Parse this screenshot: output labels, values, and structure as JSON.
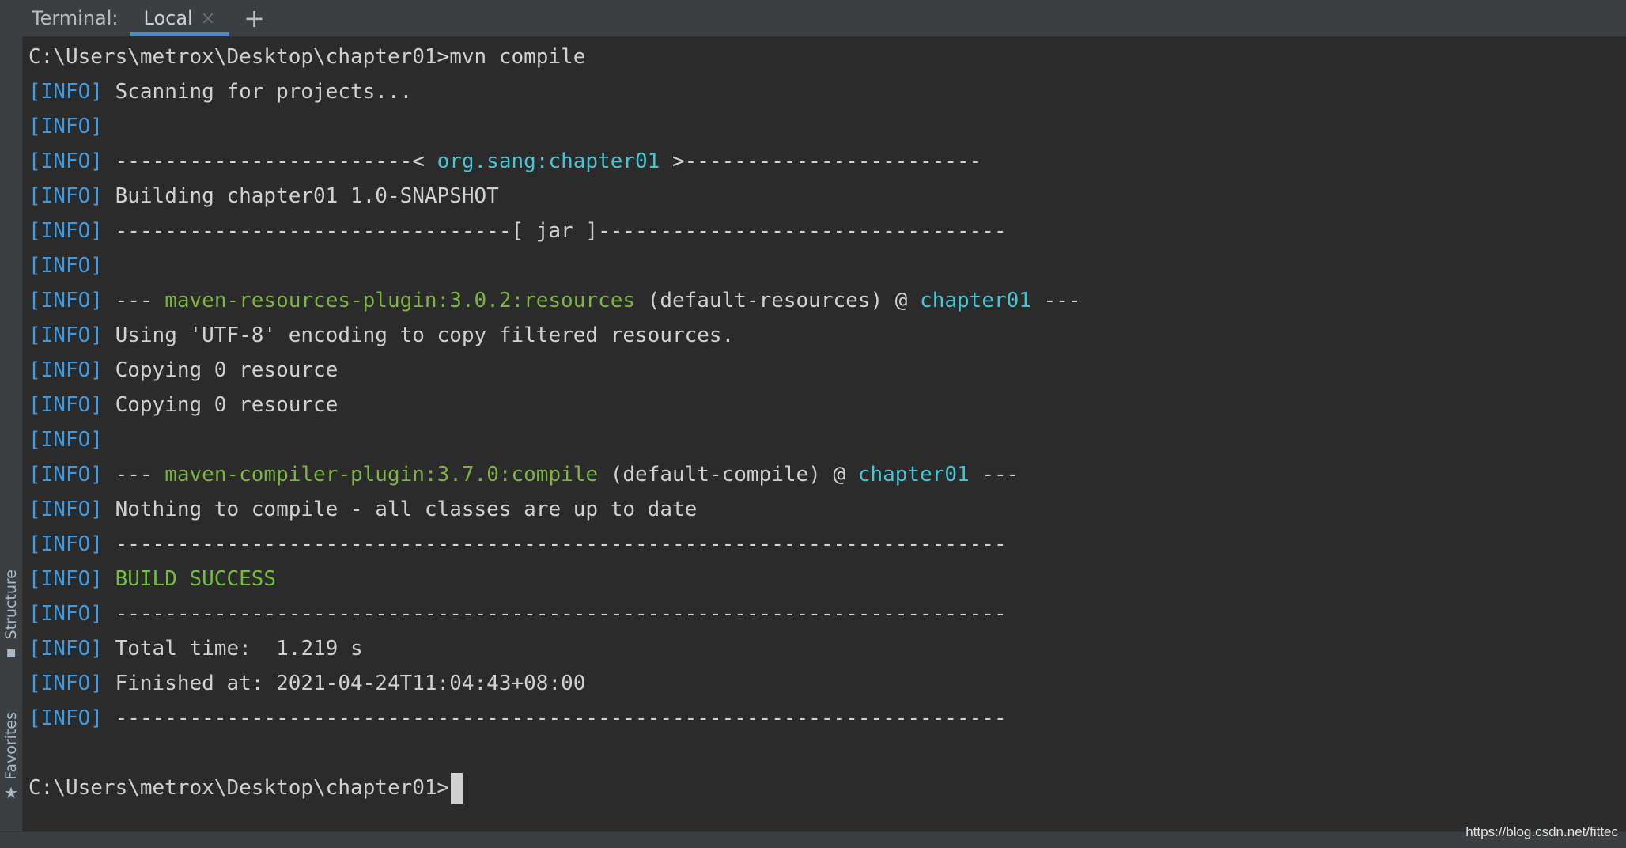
{
  "tabbar": {
    "title": "Terminal:",
    "tab_label": "Local",
    "close_icon": "×",
    "add_icon": "+"
  },
  "rail": {
    "structure_label": "Structure",
    "favorites_label": "Favorites"
  },
  "terminal": {
    "lines": [
      {
        "segments": [
          {
            "text": "C:\\Users\\metrox\\Desktop\\chapter01>mvn compile",
            "color": "default"
          }
        ]
      },
      {
        "segments": [
          {
            "text": "[INFO]",
            "color": "info"
          },
          {
            "text": " Scanning for projects...",
            "color": "default"
          }
        ]
      },
      {
        "segments": [
          {
            "text": "[INFO]",
            "color": "info"
          }
        ]
      },
      {
        "segments": [
          {
            "text": "[INFO]",
            "color": "info"
          },
          {
            "text": " ------------------------< ",
            "color": "default"
          },
          {
            "text": "org.sang:chapter01",
            "color": "cyan"
          },
          {
            "text": " >------------------------",
            "color": "default"
          }
        ]
      },
      {
        "segments": [
          {
            "text": "[INFO]",
            "color": "info"
          },
          {
            "text": " Building chapter01 1.0-SNAPSHOT",
            "color": "default"
          }
        ]
      },
      {
        "segments": [
          {
            "text": "[INFO]",
            "color": "info"
          },
          {
            "text": " --------------------------------[ jar ]---------------------------------",
            "color": "default"
          }
        ]
      },
      {
        "segments": [
          {
            "text": "[INFO]",
            "color": "info"
          }
        ]
      },
      {
        "segments": [
          {
            "text": "[INFO]",
            "color": "info"
          },
          {
            "text": " --- ",
            "color": "default"
          },
          {
            "text": "maven-resources-plugin:3.0.2:resources",
            "color": "green"
          },
          {
            "text": " (default-resources) @ ",
            "color": "default"
          },
          {
            "text": "chapter01",
            "color": "cyan"
          },
          {
            "text": " ---",
            "color": "default"
          }
        ]
      },
      {
        "segments": [
          {
            "text": "[INFO]",
            "color": "info"
          },
          {
            "text": " Using 'UTF-8' encoding to copy filtered resources.",
            "color": "default"
          }
        ]
      },
      {
        "segments": [
          {
            "text": "[INFO]",
            "color": "info"
          },
          {
            "text": " Copying 0 resource",
            "color": "default"
          }
        ]
      },
      {
        "segments": [
          {
            "text": "[INFO]",
            "color": "info"
          },
          {
            "text": " Copying 0 resource",
            "color": "default"
          }
        ]
      },
      {
        "segments": [
          {
            "text": "[INFO]",
            "color": "info"
          }
        ]
      },
      {
        "segments": [
          {
            "text": "[INFO]",
            "color": "info"
          },
          {
            "text": " --- ",
            "color": "default"
          },
          {
            "text": "maven-compiler-plugin:3.7.0:compile",
            "color": "green"
          },
          {
            "text": " (default-compile) @ ",
            "color": "default"
          },
          {
            "text": "chapter01",
            "color": "cyan"
          },
          {
            "text": " ---",
            "color": "default"
          }
        ]
      },
      {
        "segments": [
          {
            "text": "[INFO]",
            "color": "info"
          },
          {
            "text": " Nothing to compile - all classes are up to date",
            "color": "default"
          }
        ]
      },
      {
        "segments": [
          {
            "text": "[INFO]",
            "color": "info"
          },
          {
            "text": " ------------------------------------------------------------------------",
            "color": "default"
          }
        ]
      },
      {
        "segments": [
          {
            "text": "[INFO]",
            "color": "info"
          },
          {
            "text": " ",
            "color": "default"
          },
          {
            "text": "BUILD SUCCESS",
            "color": "bright-green"
          }
        ]
      },
      {
        "segments": [
          {
            "text": "[INFO]",
            "color": "info"
          },
          {
            "text": " ------------------------------------------------------------------------",
            "color": "default"
          }
        ]
      },
      {
        "segments": [
          {
            "text": "[INFO]",
            "color": "info"
          },
          {
            "text": " Total time:  1.219 s",
            "color": "default"
          }
        ]
      },
      {
        "segments": [
          {
            "text": "[INFO]",
            "color": "info"
          },
          {
            "text": " Finished at: 2021-04-24T11:04:43+08:00",
            "color": "default"
          }
        ]
      },
      {
        "segments": [
          {
            "text": "[INFO]",
            "color": "info"
          },
          {
            "text": " ------------------------------------------------------------------------",
            "color": "default"
          }
        ]
      },
      {
        "segments": []
      },
      {
        "segments": [
          {
            "text": "C:\\Users\\metrox\\Desktop\\chapter01>",
            "color": "default"
          }
        ],
        "cursor": true
      }
    ]
  },
  "watermark": "https://blog.csdn.net/fittec",
  "colors": {
    "background": "#2b2b2b",
    "info": "#3f9ae2",
    "cyan": "#41c7d4",
    "green": "#7cb342",
    "accent": "#4a88c7"
  }
}
